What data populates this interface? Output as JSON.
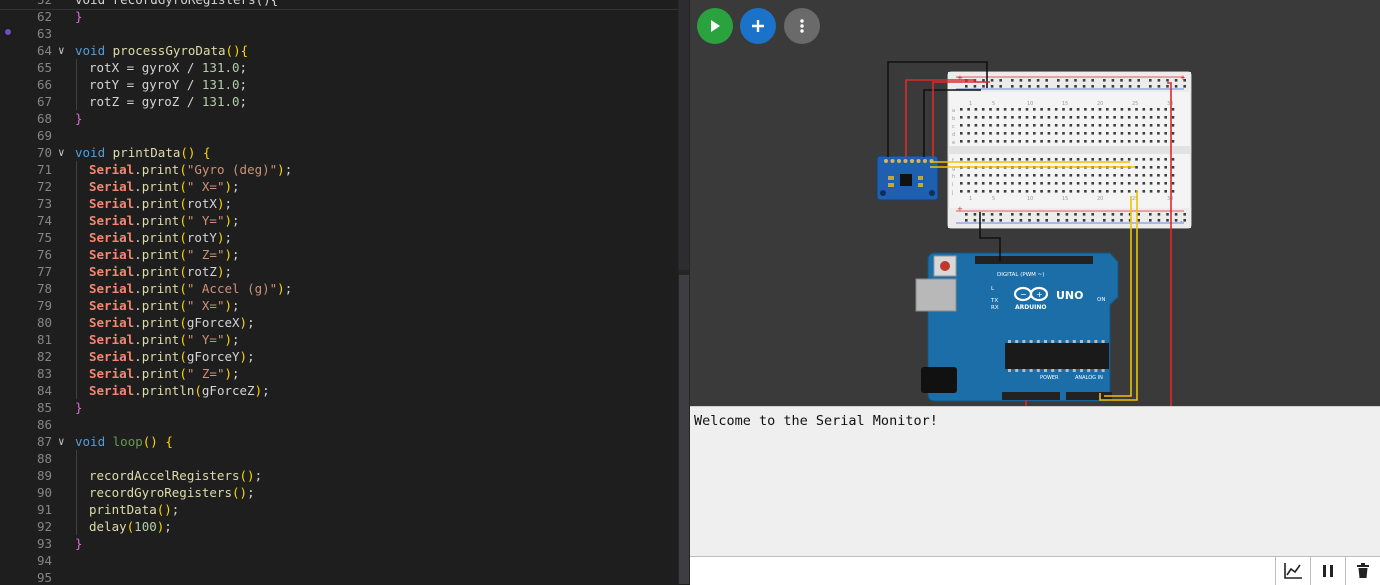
{
  "editor": {
    "sticky": {
      "line_number": "52",
      "code": "void recordGyroRegisters(){"
    },
    "lines": [
      {
        "n": "62",
        "code": "}"
      },
      {
        "n": "63",
        "code": ""
      },
      {
        "n": "64",
        "code": "void processGyroData(){"
      },
      {
        "n": "65",
        "code": "rotX = gyroX / 131.0;"
      },
      {
        "n": "66",
        "code": "rotY = gyroY / 131.0;"
      },
      {
        "n": "67",
        "code": "rotZ = gyroZ / 131.0;"
      },
      {
        "n": "68",
        "code": "}"
      },
      {
        "n": "69",
        "code": ""
      },
      {
        "n": "70",
        "code": "void printData() {"
      },
      {
        "n": "71",
        "code": "Serial.print(\"Gyro (deg)\");"
      },
      {
        "n": "72",
        "code": "Serial.print(\" X=\");"
      },
      {
        "n": "73",
        "code": "Serial.print(rotX);"
      },
      {
        "n": "74",
        "code": "Serial.print(\" Y=\");"
      },
      {
        "n": "75",
        "code": "Serial.print(rotY);"
      },
      {
        "n": "76",
        "code": "Serial.print(\" Z=\");"
      },
      {
        "n": "77",
        "code": "Serial.print(rotZ);"
      },
      {
        "n": "78",
        "code": "Serial.print(\" Accel (g)\");"
      },
      {
        "n": "79",
        "code": "Serial.print(\" X=\");"
      },
      {
        "n": "80",
        "code": "Serial.print(gForceX);"
      },
      {
        "n": "81",
        "code": "Serial.print(\" Y=\");"
      },
      {
        "n": "82",
        "code": "Serial.print(gForceY);"
      },
      {
        "n": "83",
        "code": "Serial.print(\" Z=\");"
      },
      {
        "n": "84",
        "code": "Serial.println(gForceZ);"
      },
      {
        "n": "85",
        "code": "}"
      },
      {
        "n": "86",
        "code": ""
      },
      {
        "n": "87",
        "code": "void loop() {"
      },
      {
        "n": "88",
        "code": ""
      },
      {
        "n": "89",
        "code": "recordAccelRegisters();"
      },
      {
        "n": "90",
        "code": "recordGyroRegisters();"
      },
      {
        "n": "91",
        "code": "printData();"
      },
      {
        "n": "92",
        "code": "delay(100);"
      },
      {
        "n": "93",
        "code": "}"
      },
      {
        "n": "94",
        "code": ""
      },
      {
        "n": "95",
        "code": ""
      }
    ]
  },
  "simulator": {
    "run_icon": "play-icon",
    "add_icon": "plus-icon",
    "more_icon": "vertical-dots-icon",
    "board_brand": "UNO",
    "board_name": "ARDUINO",
    "digital_label": "DIGITAL (PWM ~)",
    "power_label": "POWER",
    "analog_label": "ANALOG IN",
    "tx_label": "TX",
    "rx_label": "RX",
    "on_label": "ON",
    "l_label": "L",
    "breadboard_cols": [
      "1",
      "5",
      "10",
      "15",
      "20",
      "25",
      "30"
    ],
    "breadboard_rows_top": [
      "a",
      "b",
      "c",
      "d",
      "e"
    ],
    "breadboard_rows_bottom": [
      "f",
      "g",
      "h",
      "i",
      "j"
    ],
    "plus_label": "+",
    "minus_label": "-",
    "colors": {
      "wire_red": "#d92b2b",
      "wire_black": "#111111",
      "wire_yellow": "#f2c200",
      "board_blue": "#1b6ea8",
      "sensor_blue": "#1f5fb0"
    }
  },
  "serial": {
    "message": "Welcome to the Serial Monitor!",
    "input_value": "",
    "plot_icon": "line-chart-icon",
    "pause_icon": "pause-icon",
    "clear_icon": "trash-icon"
  }
}
